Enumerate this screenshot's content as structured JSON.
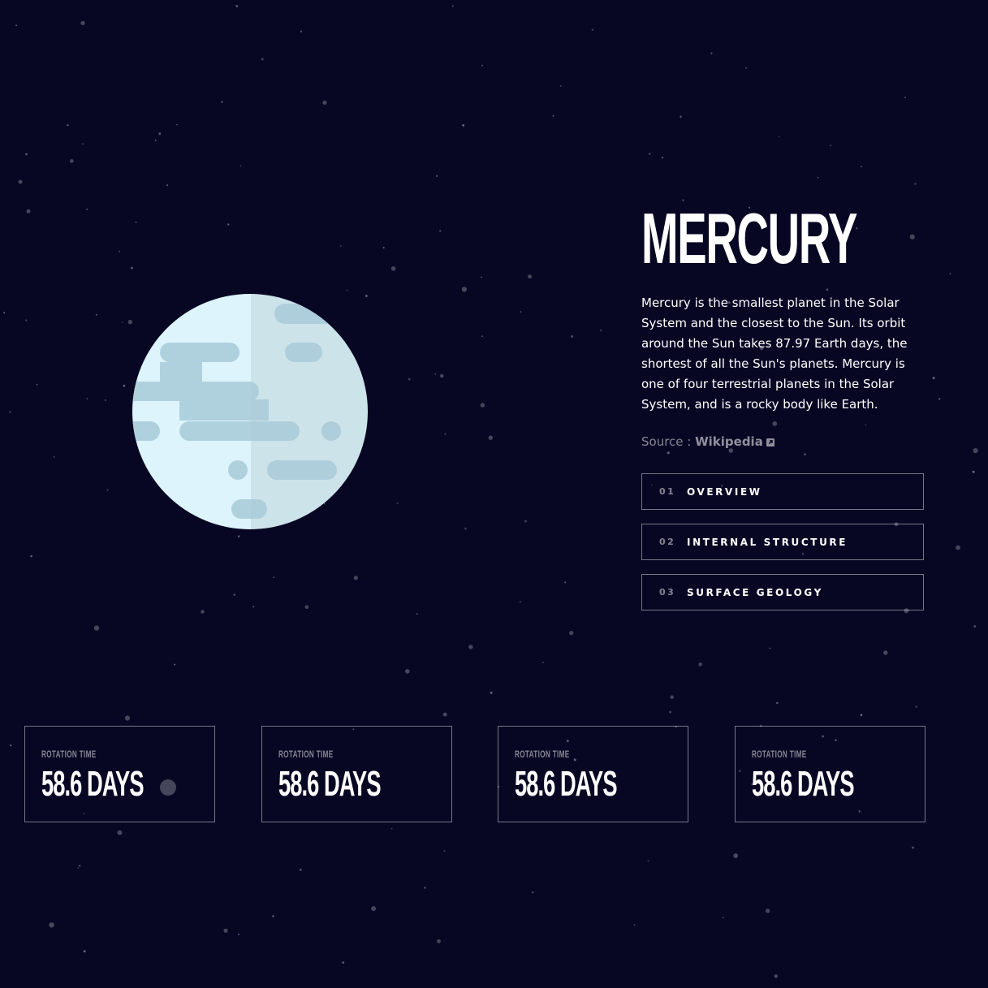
{
  "planet": {
    "name": "MERCURY",
    "description": "Mercury is the smallest planet in the Solar System and the closest to the Sun. Its orbit around the Sun takes 87.97 Earth days, the shortest of all the Sun's planets. Mercury is one of four terrestrial planets in the Solar System, and is a rocky body like Earth.",
    "source_prefix": "Source : ",
    "source_link": "Wikipedia",
    "source_icon": "external-link-icon"
  },
  "tabs": [
    {
      "number": "01",
      "label": "OVERVIEW"
    },
    {
      "number": "02",
      "label": "INTERNAL STRUCTURE"
    },
    {
      "number": "03",
      "label": "SURFACE GEOLOGY"
    }
  ],
  "stats": [
    {
      "label": "ROTATION TIME",
      "value": "58.6 DAYS"
    },
    {
      "label": "ROTATION TIME",
      "value": "58.6 DAYS"
    },
    {
      "label": "ROTATION TIME",
      "value": "58.6 DAYS"
    },
    {
      "label": "ROTATION TIME",
      "value": "58.6 DAYS"
    }
  ],
  "colors": {
    "background": "#070724",
    "planet_light": "#DEF4FC",
    "planet_dark": "#CDE3EA",
    "crater": "#A7CBD8",
    "text": "#FFFFFF"
  }
}
